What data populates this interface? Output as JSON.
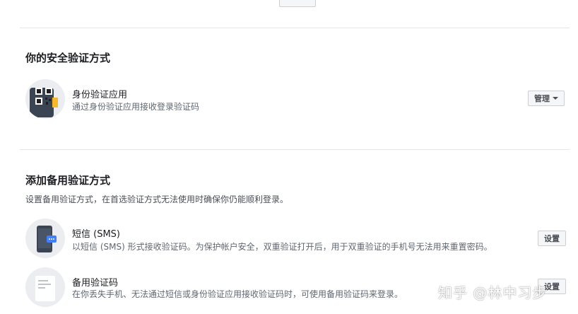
{
  "security_methods": {
    "title": "你的安全验证方式",
    "items": [
      {
        "icon": "qr-code-phone-icon",
        "title": "身份验证应用",
        "desc": "通过身份验证应用接收登录验证码",
        "button_label": "管理"
      }
    ]
  },
  "backup_methods": {
    "title": "添加备用验证方式",
    "desc": "设置备用验证方式，在首选验证方式无法使用时确保你仍能顺利登录。",
    "items": [
      {
        "icon": "sms-phone-icon",
        "title": "短信 (SMS)",
        "desc": "以短信 (SMS) 形式接收验证码。为保护帐户安全，双重验证打开后，用于双重验证的手机号无法用来重置密码。",
        "button_label": "设置"
      },
      {
        "icon": "backup-codes-document-icon",
        "title": "备用验证码",
        "desc": "在你丢失手机、无法通过短信或身份验证应用接收验证码时，可使用备用验证码来登录。",
        "button_label": "设置"
      }
    ]
  },
  "watermark": "知乎 @林中习步",
  "colors": {
    "divider": "#e5e6e9",
    "button_bg": "#f5f6f7",
    "button_border": "#ccd0d5"
  }
}
